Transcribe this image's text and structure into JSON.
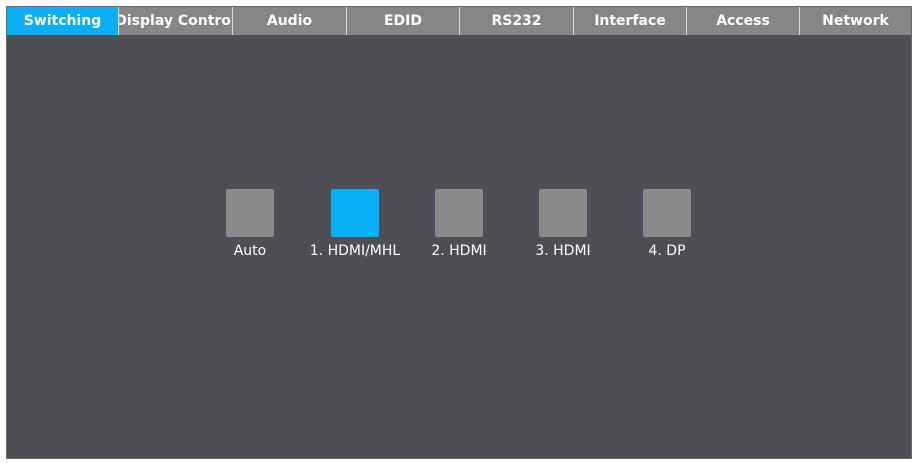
{
  "tabs": [
    {
      "label": "Switching",
      "active": true
    },
    {
      "label": "Display Control",
      "active": false
    },
    {
      "label": "Audio",
      "active": false
    },
    {
      "label": "EDID",
      "active": false
    },
    {
      "label": "RS232",
      "active": false
    },
    {
      "label": "Interface",
      "active": false
    },
    {
      "label": "Access",
      "active": false
    },
    {
      "label": "Network",
      "active": false
    }
  ],
  "inputs": [
    {
      "label": "Auto",
      "selected": false
    },
    {
      "label": "1. HDMI/MHL",
      "selected": true
    },
    {
      "label": "2. HDMI",
      "selected": false
    },
    {
      "label": "3. HDMI",
      "selected": false
    },
    {
      "label": "4. DP",
      "selected": false
    }
  ],
  "colors": {
    "accent": "#0aaef3",
    "panel_background": "#4e4f54",
    "tab_inactive": "#868688",
    "button_inactive": "#8a8a8b"
  }
}
